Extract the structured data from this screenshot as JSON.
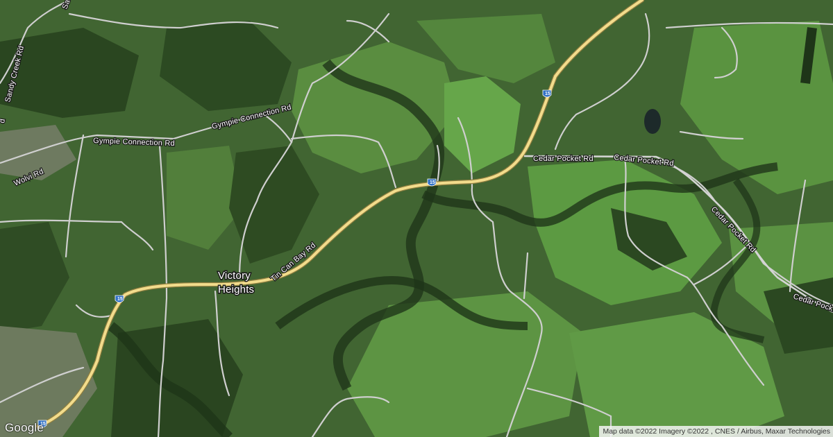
{
  "map": {
    "type": "satellite",
    "places": {
      "victory_line1": "Victory",
      "victory_line2": "Heights"
    },
    "roads": {
      "sandy_creek": "Sandy Creek Rd",
      "sandy_top": "Sa",
      "gympie_conn_1": "Gympie Connection Rd",
      "gympie_conn_2": "Gympie Connection Rd",
      "wolvi": "Wolvi Rd",
      "tin_can_bay": "Tin Can Bay Rd",
      "cedar_pocket_1": "Cedar Pocket Rd",
      "cedar_pocket_2": "Cedar Pocket Rd",
      "cedar_pocket_3": "Cedar Pocket Rd",
      "cedar_pocket_4": "Cedar Pock",
      "left_edge": "d"
    },
    "shields": [
      "15",
      "15",
      "15",
      "15"
    ],
    "logo": "Google",
    "attribution": "Map data ©2022 Imagery ©2022 , CNES / Airbus, Maxar Technologies",
    "colors": {
      "highway": "#f2dc8c",
      "road": "#c9c9c9",
      "shield": "#2f6fc4",
      "pasture": "#4f8a3a",
      "forest": "#25401c"
    }
  }
}
